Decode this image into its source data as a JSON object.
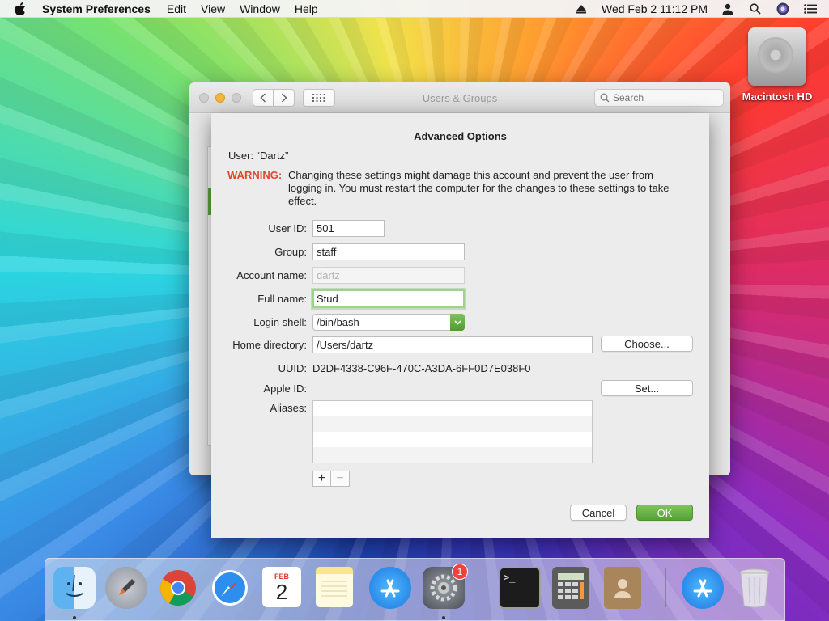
{
  "menubar": {
    "app_name": "System Preferences",
    "menus": [
      "Edit",
      "View",
      "Window",
      "Help"
    ],
    "clock": "Wed Feb 2  11:12 PM"
  },
  "desktop": {
    "disk_label": "Macintosh HD"
  },
  "window": {
    "title": "Users & Groups",
    "search_placeholder": "Search"
  },
  "sheet": {
    "title": "Advanced Options",
    "user_line": "User:  “Dartz”",
    "warning_label": "WARNING:",
    "warning_text": "Changing these settings might damage this account and prevent the user from logging in. You must restart the computer for the changes to these settings to take effect.",
    "fields": {
      "user_id_label": "User ID:",
      "user_id_value": "501",
      "group_label": "Group:",
      "group_value": "staff",
      "account_name_label": "Account name:",
      "account_name_value": "dartz",
      "full_name_label": "Full name:",
      "full_name_value": "Stud",
      "login_shell_label": "Login shell:",
      "login_shell_value": "/bin/bash",
      "home_dir_label": "Home directory:",
      "home_dir_value": "/Users/dartz",
      "uuid_label": "UUID:",
      "uuid_value": "D2DF4338-C96F-470C-A3DA-6FF0D7E038F0",
      "apple_id_label": "Apple ID:",
      "aliases_label": "Aliases:"
    },
    "buttons": {
      "choose": "Choose...",
      "set": "Set...",
      "plus": "+",
      "minus": "−",
      "cancel": "Cancel",
      "ok": "OK"
    }
  },
  "dock": {
    "calendar_month": "FEB",
    "calendar_day": "2",
    "system_prefs_badge": "1",
    "terminal_prompt": ">_"
  },
  "colors": {
    "accent_green": "#5aa83f",
    "warning_red": "#e5452b"
  }
}
